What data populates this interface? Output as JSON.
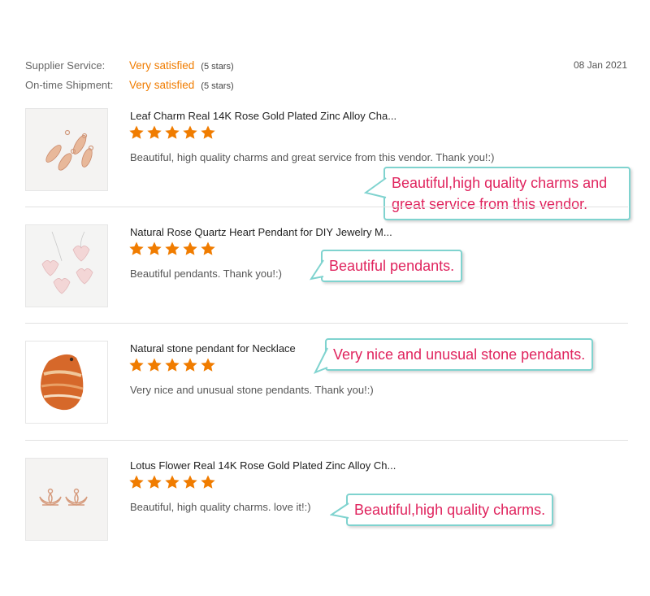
{
  "feedback": {
    "supplier_label": "Supplier Service:",
    "supplier_value": "Very satisfied",
    "supplier_stars": "(5 stars)",
    "shipment_label": "On-time Shipment:",
    "shipment_value": "Very satisfied",
    "shipment_stars": "(5 stars)",
    "date": "08 Jan 2021"
  },
  "colors": {
    "accent": "#f07c00",
    "callout_text": "#e0245e",
    "callout_border": "#7fd3cf"
  },
  "reviews": [
    {
      "title": "Leaf Charm Real 14K Rose Gold Plated Zinc Alloy Cha...",
      "rating": 5,
      "comment": "Beautiful, high quality charms and great service from this vendor. Thank you!:)",
      "callout": [
        "Beautiful,high quality charms and",
        "great service from this vendor."
      ]
    },
    {
      "title": "Natural Rose Quartz Heart Pendant for DIY Jewelry M...",
      "rating": 5,
      "comment": "Beautiful pendants. Thank you!:)",
      "callout": [
        "Beautiful pendants."
      ]
    },
    {
      "title": "Natural stone pendant for Necklace",
      "rating": 5,
      "comment": "Very nice and unusual stone pendants. Thank you!:)",
      "callout": [
        "Very nice and unusual stone pendants."
      ]
    },
    {
      "title": "Lotus Flower Real 14K Rose Gold Plated Zinc Alloy Ch...",
      "rating": 5,
      "comment": "Beautiful, high quality charms. love it!:)",
      "callout": [
        "Beautiful,high quality charms."
      ]
    }
  ]
}
